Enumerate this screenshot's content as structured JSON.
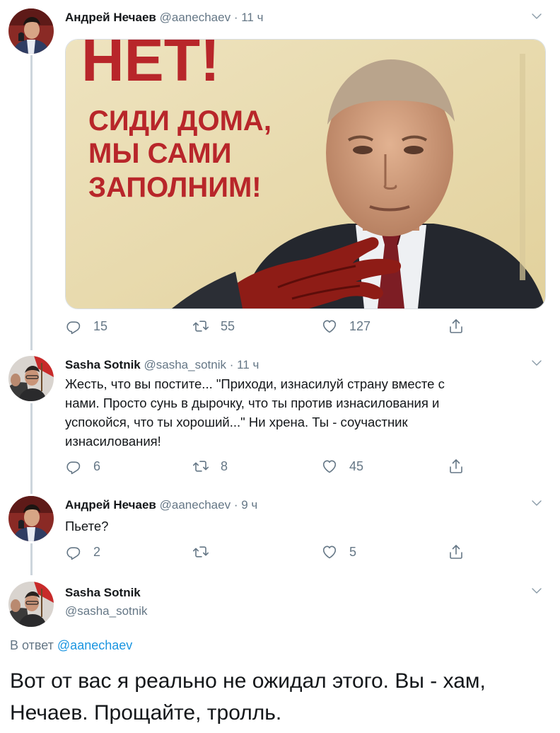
{
  "tweets": [
    {
      "author": "Андрей Нечаев",
      "handle": "@aanechaev",
      "separator": "·",
      "time": "11 ч",
      "media": {
        "title": "НЕТ!",
        "lines": [
          "СИДИ ДОМА,",
          "МЫ САМИ",
          "ЗАПОЛНИМ!"
        ]
      },
      "actions": {
        "replies": "15",
        "retweets": "55",
        "likes": "127"
      }
    },
    {
      "author": "Sasha Sotnik",
      "handle": "@sasha_sotnik",
      "separator": "·",
      "time": "11 ч",
      "text_lines": [
        "Жесть, что вы постите... \"Приходи, изнасилуй страну вместе с",
        "нами. Просто сунь в дырочку, что ты против изнасилования и",
        "успокойся, что ты хороший...\" Ни хрена. Ты - соучастник",
        "изнасилования!"
      ],
      "actions": {
        "replies": "6",
        "retweets": "8",
        "likes": "45"
      }
    },
    {
      "author": "Андрей Нечаев",
      "handle": "@aanechaev",
      "separator": "·",
      "time": "9 ч",
      "text_lines": [
        "Пьете?"
      ],
      "actions": {
        "replies": "2",
        "retweets": "",
        "likes": "5"
      }
    }
  ],
  "focused": {
    "author": "Sasha Sotnik",
    "handle": "@sasha_sotnik",
    "reply_prefix": "В ответ",
    "reply_to": "@aanechaev",
    "text_lines": [
      "Вот от вас я реально не ожидал этого. Вы - хам,",
      "Нечаев. Прощайте, тролль."
    ]
  },
  "colors": {
    "text": "#14171a",
    "secondary": "#657786",
    "link": "#1b95e0",
    "thread_line": "#cdd5dc",
    "poster_red": "#b8262a"
  },
  "icons": [
    "reply-icon",
    "retweet-icon",
    "like-icon",
    "share-icon",
    "chevron-down-icon"
  ]
}
